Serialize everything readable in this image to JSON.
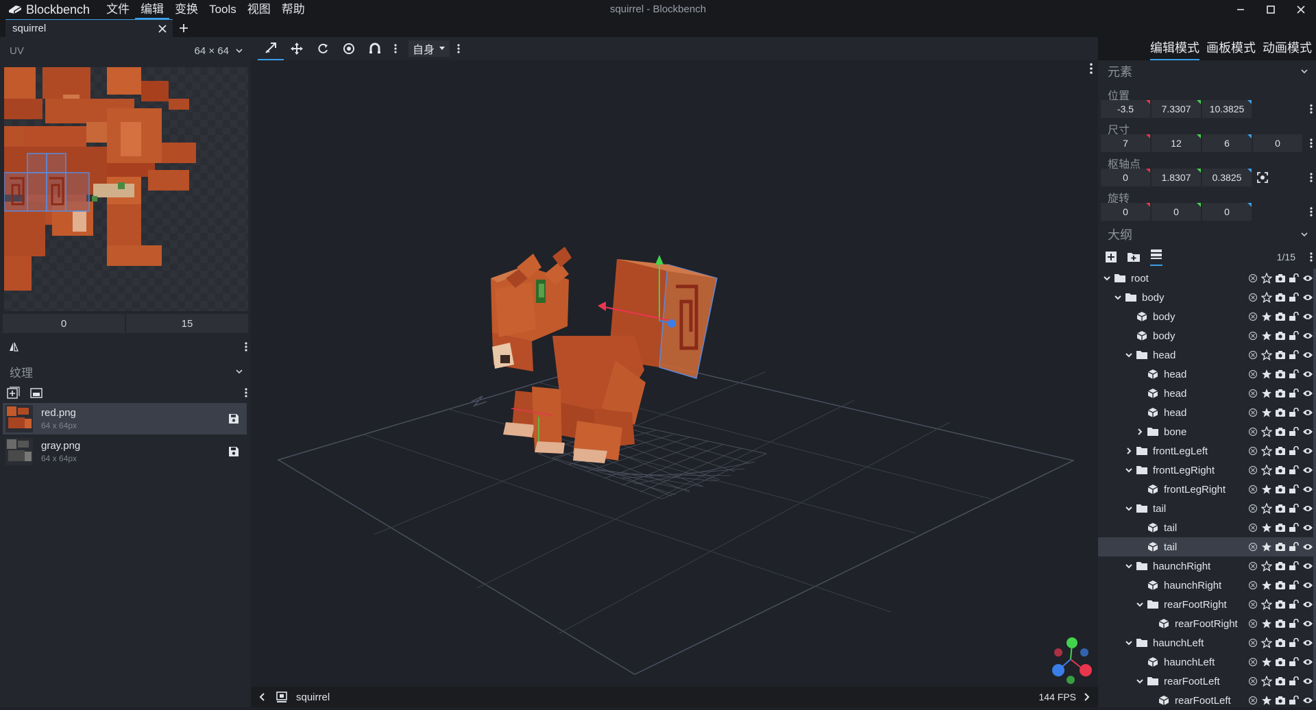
{
  "app": {
    "name": "Blockbench",
    "window_title": "squirrel - Blockbench",
    "menu": [
      "文件",
      "编辑",
      "变换",
      "Tools",
      "视图",
      "帮助"
    ]
  },
  "tabs": [
    {
      "label": "squirrel"
    }
  ],
  "uv_panel": {
    "title": "UV",
    "size": "64 × 64",
    "fields": [
      "0",
      "15"
    ]
  },
  "textures_panel": {
    "title": "纹理",
    "items": [
      {
        "name": "red.png",
        "dims": "64 x 64px",
        "selected": true
      },
      {
        "name": "gray.png",
        "dims": "64 x 64px",
        "selected": false
      }
    ]
  },
  "toolbar": {
    "space_select": "自身"
  },
  "modes": [
    {
      "label": "编辑模式",
      "active": true
    },
    {
      "label": "画板模式",
      "active": false
    },
    {
      "label": "动画模式",
      "active": false
    }
  ],
  "element_panel": {
    "title": "元素",
    "position": {
      "label": "位置",
      "values": [
        "-3.5",
        "7.3307",
        "10.3825"
      ]
    },
    "size": {
      "label": "尺寸",
      "values": [
        "7",
        "12",
        "6",
        "0"
      ]
    },
    "pivot": {
      "label": "枢轴点",
      "values": [
        "0",
        "1.8307",
        "0.3825"
      ]
    },
    "rotation": {
      "label": "旋转",
      "values": [
        "0",
        "0",
        "0"
      ]
    }
  },
  "outliner": {
    "title": "大纲",
    "count": "1/15",
    "nodes": [
      {
        "name": "root",
        "type": "group",
        "depth": 0,
        "expanded": true
      },
      {
        "name": "body",
        "type": "group",
        "depth": 1,
        "expanded": true
      },
      {
        "name": "body",
        "type": "cube",
        "depth": 2
      },
      {
        "name": "body",
        "type": "cube",
        "depth": 2
      },
      {
        "name": "head",
        "type": "group",
        "depth": 2,
        "expanded": true
      },
      {
        "name": "head",
        "type": "cube",
        "depth": 3
      },
      {
        "name": "head",
        "type": "cube",
        "depth": 3
      },
      {
        "name": "head",
        "type": "cube",
        "depth": 3
      },
      {
        "name": "bone",
        "type": "group",
        "depth": 3,
        "expanded": false
      },
      {
        "name": "frontLegLeft",
        "type": "group",
        "depth": 2,
        "expanded": false
      },
      {
        "name": "frontLegRight",
        "type": "group",
        "depth": 2,
        "expanded": true
      },
      {
        "name": "frontLegRight",
        "type": "cube",
        "depth": 3
      },
      {
        "name": "tail",
        "type": "group",
        "depth": 2,
        "expanded": true
      },
      {
        "name": "tail",
        "type": "cube",
        "depth": 3
      },
      {
        "name": "tail",
        "type": "cube",
        "depth": 3,
        "selected": true
      },
      {
        "name": "haunchRight",
        "type": "group",
        "depth": 2,
        "expanded": true
      },
      {
        "name": "haunchRight",
        "type": "cube",
        "depth": 3
      },
      {
        "name": "rearFootRight",
        "type": "group",
        "depth": 3,
        "expanded": true
      },
      {
        "name": "rearFootRight",
        "type": "cube",
        "depth": 4
      },
      {
        "name": "haunchLeft",
        "type": "group",
        "depth": 2,
        "expanded": true
      },
      {
        "name": "haunchLeft",
        "type": "cube",
        "depth": 3
      },
      {
        "name": "rearFootLeft",
        "type": "group",
        "depth": 3,
        "expanded": true
      },
      {
        "name": "rearFootLeft",
        "type": "cube",
        "depth": 4
      }
    ]
  },
  "viewport": {
    "footer_label": "squirrel",
    "fps": "144 FPS"
  },
  "colors": {
    "accent": "#3a9fe8",
    "axis_x": "#e8364f",
    "axis_y": "#43d34c",
    "axis_z": "#3a7fe8"
  }
}
